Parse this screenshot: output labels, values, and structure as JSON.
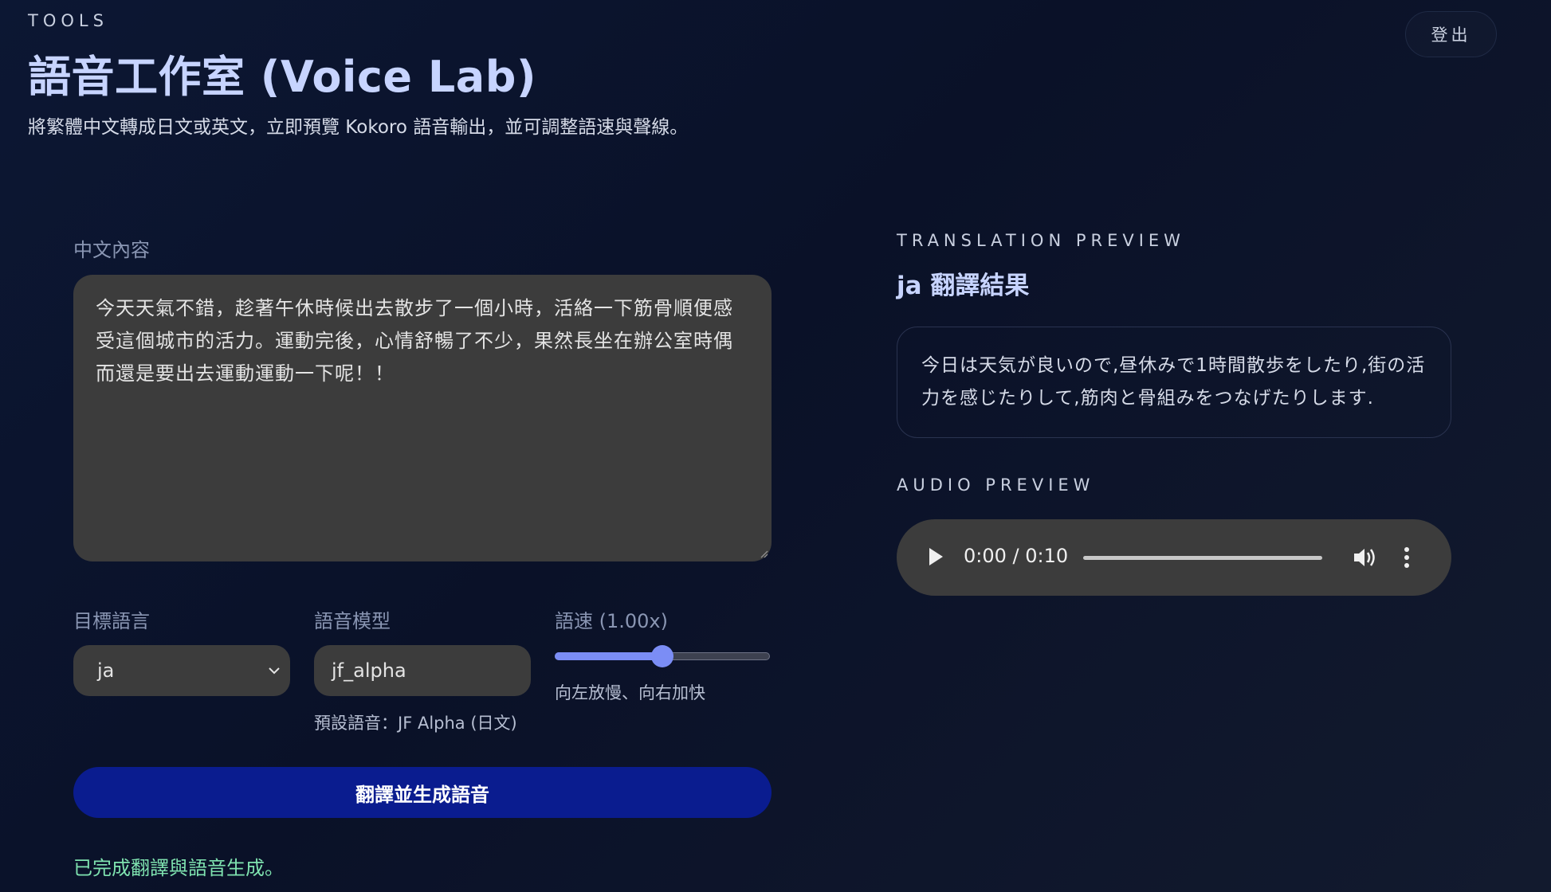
{
  "header": {
    "eyebrow": "TOOLS",
    "title": "語音工作室 (Voice Lab)",
    "subtitle": "將繁體中文轉成日文或英文，立即預覽 Kokoro 語音輸出，並可調整語速與聲線。",
    "logout_label": "登出"
  },
  "form": {
    "content_label": "中文內容",
    "content_value": "今天天氣不錯，趁著午休時候出去散步了一個小時，活絡一下筋骨順便感受這個城市的活力。運動完後，心情舒暢了不少，果然長坐在辦公室時偶而還是要出去運動運動一下呢！！",
    "language_label": "目標語言",
    "language_value": "ja",
    "voice_label": "語音模型",
    "voice_value": "jf_alpha",
    "voice_hint": "預設語音：JF Alpha (日文)",
    "speed_label": "語速 (1.00x)",
    "speed_value": 1.0,
    "speed_fraction": 0.5,
    "speed_hint": "向左放慢、向右加快",
    "submit_label": "翻譯並生成語音",
    "status": "已完成翻譯與語音生成。"
  },
  "preview": {
    "translation_eyebrow": "TRANSLATION PREVIEW",
    "translation_title": "ja 翻譯結果",
    "translation_text": "今日は天気が良いので,昼休みで1時間散歩をしたり,街の活力を感じたりして,筋肉と骨組みをつなげたりします.",
    "audio_eyebrow": "AUDIO PREVIEW",
    "audio_time": "0:00 / 0:10",
    "audio_progress": 0
  },
  "colors": {
    "accent": "#7b8df5",
    "primary_button": "#0a1c8f",
    "status_success": "#7fe3b0",
    "title": "#c7d4ff"
  },
  "icons": {
    "play": "play-icon",
    "volume": "volume-icon",
    "more": "more-vertical-icon",
    "chevron": "chevron-down-icon"
  }
}
